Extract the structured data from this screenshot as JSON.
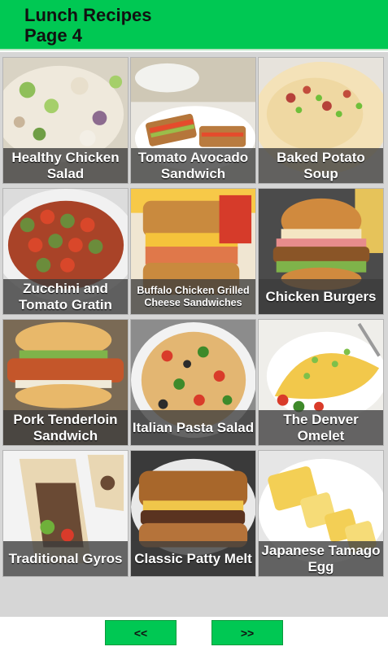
{
  "header": {
    "title": "Lunch Recipes\nPage 4"
  },
  "recipes": [
    {
      "name": "Healthy Chicken Salad"
    },
    {
      "name": "Tomato Avocado Sandwich"
    },
    {
      "name": "Baked Potato Soup"
    },
    {
      "name": "Zucchini and Tomato Gratin"
    },
    {
      "name": "Buffalo Chicken Grilled Cheese Sandwiches"
    },
    {
      "name": "Chicken Burgers"
    },
    {
      "name": "Pork Tenderloin Sandwich"
    },
    {
      "name": "Italian Pasta Salad"
    },
    {
      "name": "The Denver Omelet"
    },
    {
      "name": "Traditional Gyros"
    },
    {
      "name": "Classic Patty Melt"
    },
    {
      "name": "Japanese Tamago Egg"
    }
  ],
  "nav": {
    "prev_label": "<<",
    "next_label": ">>"
  },
  "colors": {
    "accent": "#00c853",
    "panel": "#d6d6d6",
    "caption_bg": "#3c3c3c"
  }
}
